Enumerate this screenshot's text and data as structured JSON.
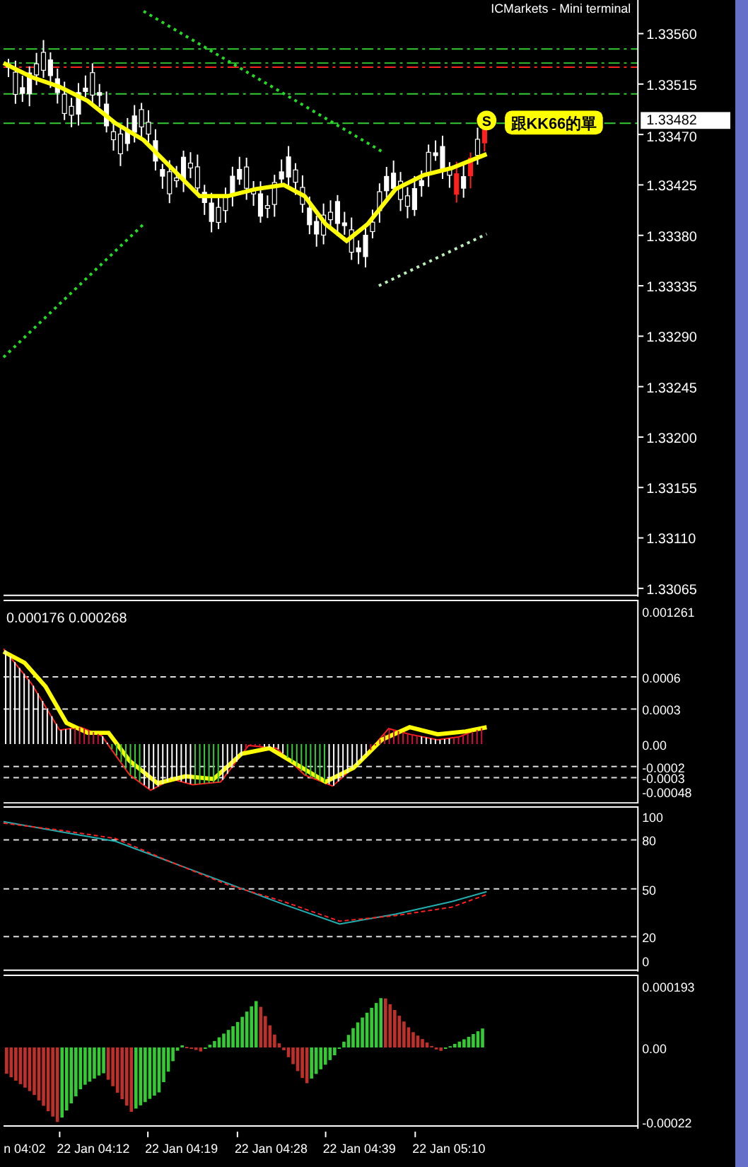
{
  "header": {
    "title": "ICMarkets - Mini terminal"
  },
  "price_axis": {
    "ticks": [
      "1.33560",
      "1.33515",
      "1.33470",
      "1.33425",
      "1.33380",
      "1.33335",
      "1.33290",
      "1.33245",
      "1.33200",
      "1.33155",
      "1.33110",
      "1.33065"
    ],
    "current_price": "1.33482"
  },
  "signal": {
    "badge": "S",
    "label": "跟KK66的單"
  },
  "macd": {
    "legend": "0.000176 0.000268",
    "ticks": [
      "0.001261",
      "0.0006",
      "0.0003",
      "0.00",
      "-0.0002",
      "-0.0003",
      "-0.00048"
    ]
  },
  "stochastic": {
    "ticks": [
      "100",
      "80",
      "50",
      "20",
      "0"
    ]
  },
  "oscillator": {
    "ticks": [
      "0.000193",
      "0.00",
      "-0.00022"
    ]
  },
  "time_axis": [
    "n 04:02",
    "22 Jan 04:12",
    "22 Jan 04:19",
    "22 Jan 04:28",
    "22 Jan 04:39",
    "22 Jan 05:10"
  ]
}
